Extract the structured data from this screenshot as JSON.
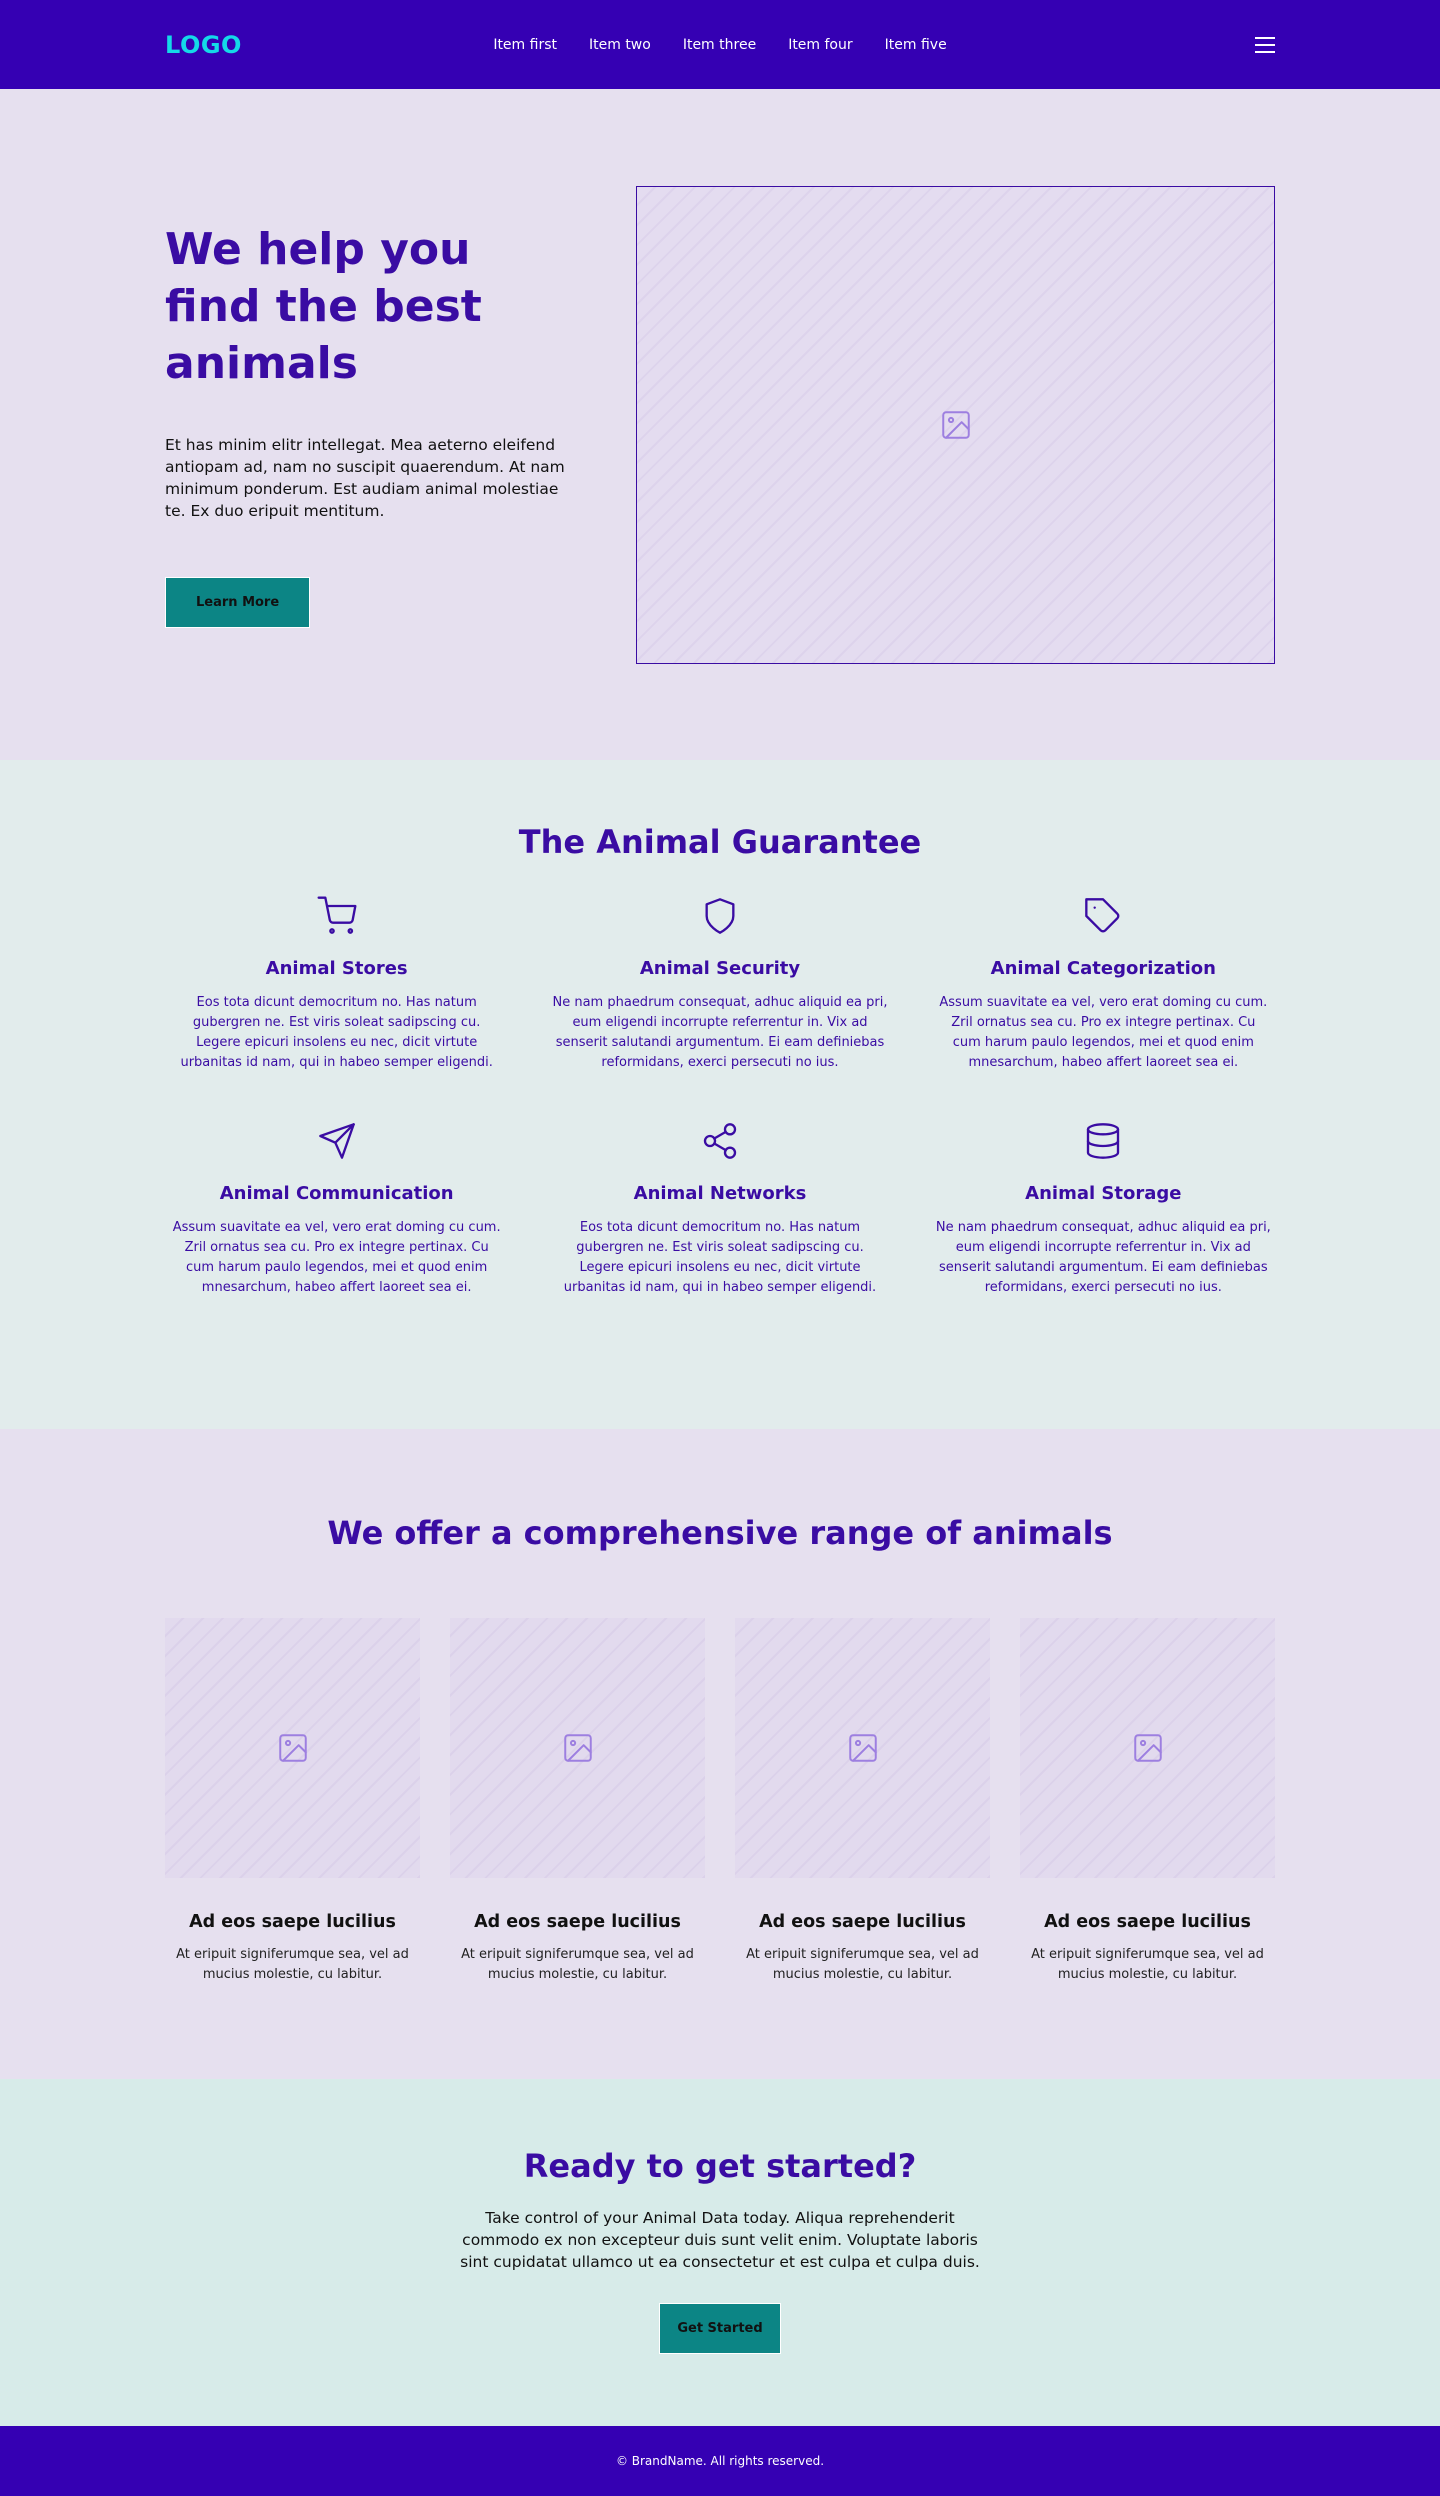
{
  "header": {
    "logo": "LOGO",
    "nav": [
      "Item first",
      "Item two",
      "Item three",
      "Item four",
      "Item five"
    ]
  },
  "hero": {
    "title": "We help you find the best animals",
    "text": "Et has minim elitr intellegat. Mea aeterno eleifend antiopam ad, nam no suscipit quaerendum. At nam minimum ponderum. Est audiam animal molestiae te. Ex duo eripuit mentitum.",
    "button": "Learn More"
  },
  "guarantee": {
    "title": "The Animal Guarantee",
    "features": [
      {
        "icon": "cart-icon",
        "title": "Animal Stores",
        "text": "Eos tota dicunt democritum no. Has natum gubergren ne. Est viris soleat sadipscing cu. Legere epicuri insolens eu nec, dicit virtute urbanitas id nam, qui in habeo semper eligendi."
      },
      {
        "icon": "shield-icon",
        "title": "Animal Security",
        "text": "Ne nam phaedrum consequat, adhuc aliquid ea pri, eum eligendi incorrupte referrentur in. Vix ad senserit salutandi argumentum. Ei eam definiebas reformidans, exerci persecuti no ius."
      },
      {
        "icon": "tag-icon",
        "title": "Animal Categorization",
        "text": "Assum suavitate ea vel, vero erat doming cu cum. Zril ornatus sea cu. Pro ex integre pertinax. Cu cum harum paulo legendos, mei et quod enim mnesarchum, habeo affert laoreet sea ei."
      },
      {
        "icon": "send-icon",
        "title": "Animal Communication",
        "text": "Assum suavitate ea vel, vero erat doming cu cum. Zril ornatus sea cu. Pro ex integre pertinax. Cu cum harum paulo legendos, mei et quod enim mnesarchum, habeo affert laoreet sea ei."
      },
      {
        "icon": "share-icon",
        "title": "Animal Networks",
        "text": "Eos tota dicunt democritum no. Has natum gubergren ne. Est viris soleat sadipscing cu. Legere epicuri insolens eu nec, dicit virtute urbanitas id nam, qui in habeo semper eligendi."
      },
      {
        "icon": "database-icon",
        "title": "Animal Storage",
        "text": "Ne nam phaedrum consequat, adhuc aliquid ea pri, eum eligendi incorrupte referrentur in. Vix ad senserit salutandi argumentum. Ei eam definiebas reformidans, exerci persecuti no ius."
      }
    ]
  },
  "offer": {
    "title": "We offer a comprehensive range of animals",
    "cards": [
      {
        "title": "Ad eos saepe lucilius",
        "text": "At eripuit signiferumque sea, vel ad mucius molestie, cu labitur."
      },
      {
        "title": "Ad eos saepe lucilius",
        "text": "At eripuit signiferumque sea, vel ad mucius molestie, cu labitur."
      },
      {
        "title": "Ad eos saepe lucilius",
        "text": "At eripuit signiferumque sea, vel ad mucius molestie, cu labitur."
      },
      {
        "title": "Ad eos saepe lucilius",
        "text": "At eripuit signiferumque sea, vel ad mucius molestie, cu labitur."
      }
    ]
  },
  "cta": {
    "title": "Ready to get started?",
    "text": "Take control of your Animal Data today. Aliqua reprehenderit commodo ex non excepteur duis sunt velit enim. Voluptate laboris sint cupidatat ullamco ut ea consectetur et est culpa et culpa duis.",
    "button": "Get Started"
  },
  "footer": {
    "copyright": "© BrandName. All rights reserved."
  },
  "colors": {
    "brand": "#3500b3",
    "heading": "#3a0ca3",
    "accent": "#0c8585",
    "logo": "#14d9e8"
  }
}
